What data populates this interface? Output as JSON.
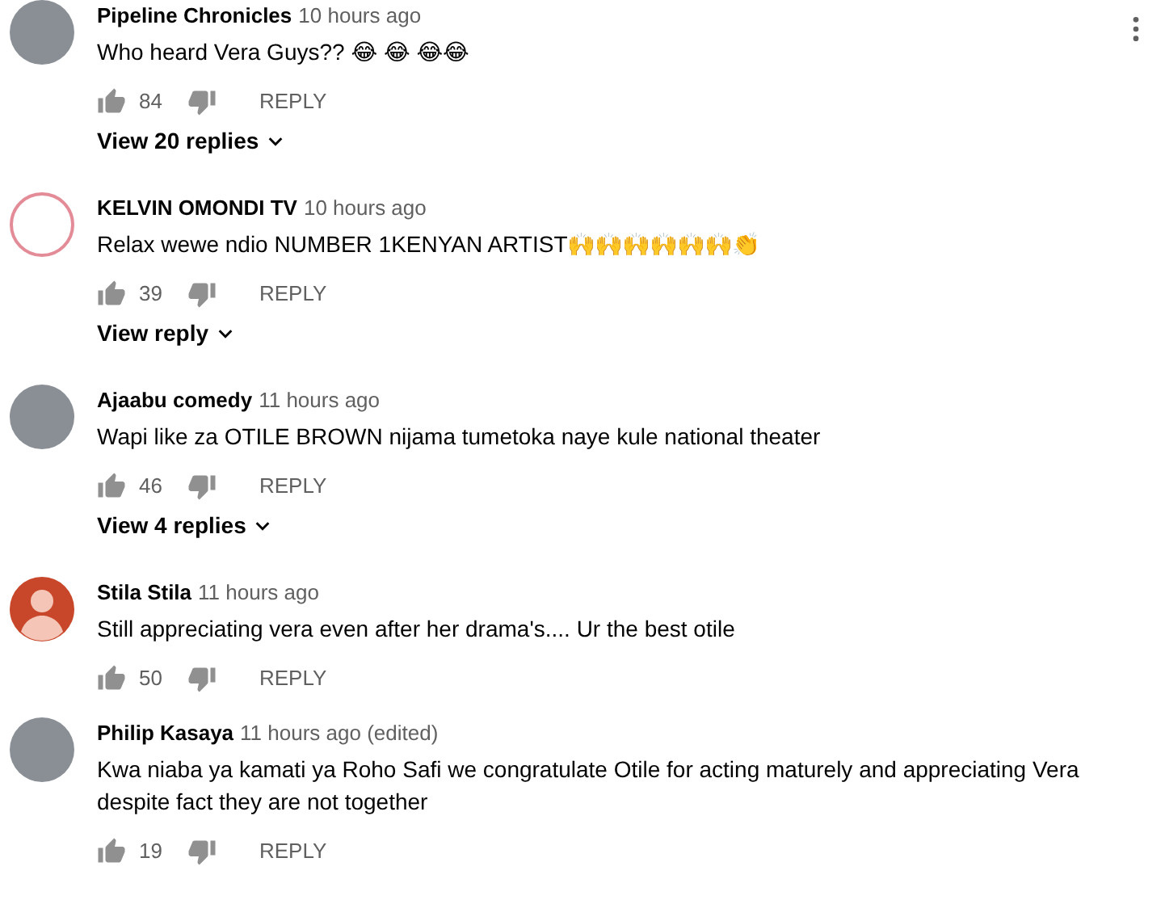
{
  "comments": [
    {
      "avatar": {
        "kind": "photo"
      },
      "author": "Pipeline Chronicles",
      "time": "10 hours ago",
      "text": "Who heard Vera Guys?? 😂 😂 😂😂",
      "likes": "84",
      "reply_label": "REPLY",
      "view_replies": "View 20 replies",
      "show_menu": true
    },
    {
      "avatar": {
        "kind": "logo"
      },
      "author": "KELVIN OMONDI TV",
      "time": "10 hours ago",
      "text": "Relax wewe ndio NUMBER 1KENYAN ARTIST🙌🙌🙌🙌🙌🙌👏",
      "likes": "39",
      "reply_label": "REPLY",
      "view_replies": "View reply",
      "show_menu": false
    },
    {
      "avatar": {
        "kind": "photo"
      },
      "author": "Ajaabu comedy",
      "time": "11 hours ago",
      "text": "Wapi like za OTILE BROWN nijama tumetoka naye kule national theater",
      "likes": "46",
      "reply_label": "REPLY",
      "view_replies": "View 4 replies",
      "show_menu": false
    },
    {
      "avatar": {
        "kind": "default"
      },
      "author": "Stila Stila",
      "time": "11 hours ago",
      "text": "Still appreciating vera even after her drama's.... Ur the best otile",
      "likes": "50",
      "reply_label": "REPLY",
      "show_menu": false
    },
    {
      "avatar": {
        "kind": "photo"
      },
      "author": "Philip Kasaya",
      "time": "11 hours ago (edited)",
      "text": "Kwa niaba ya kamati ya Roho Safi we congratulate Otile for acting maturely and appreciating Vera despite fact they are not together",
      "likes": "19",
      "reply_label": "REPLY",
      "show_menu": false
    }
  ]
}
